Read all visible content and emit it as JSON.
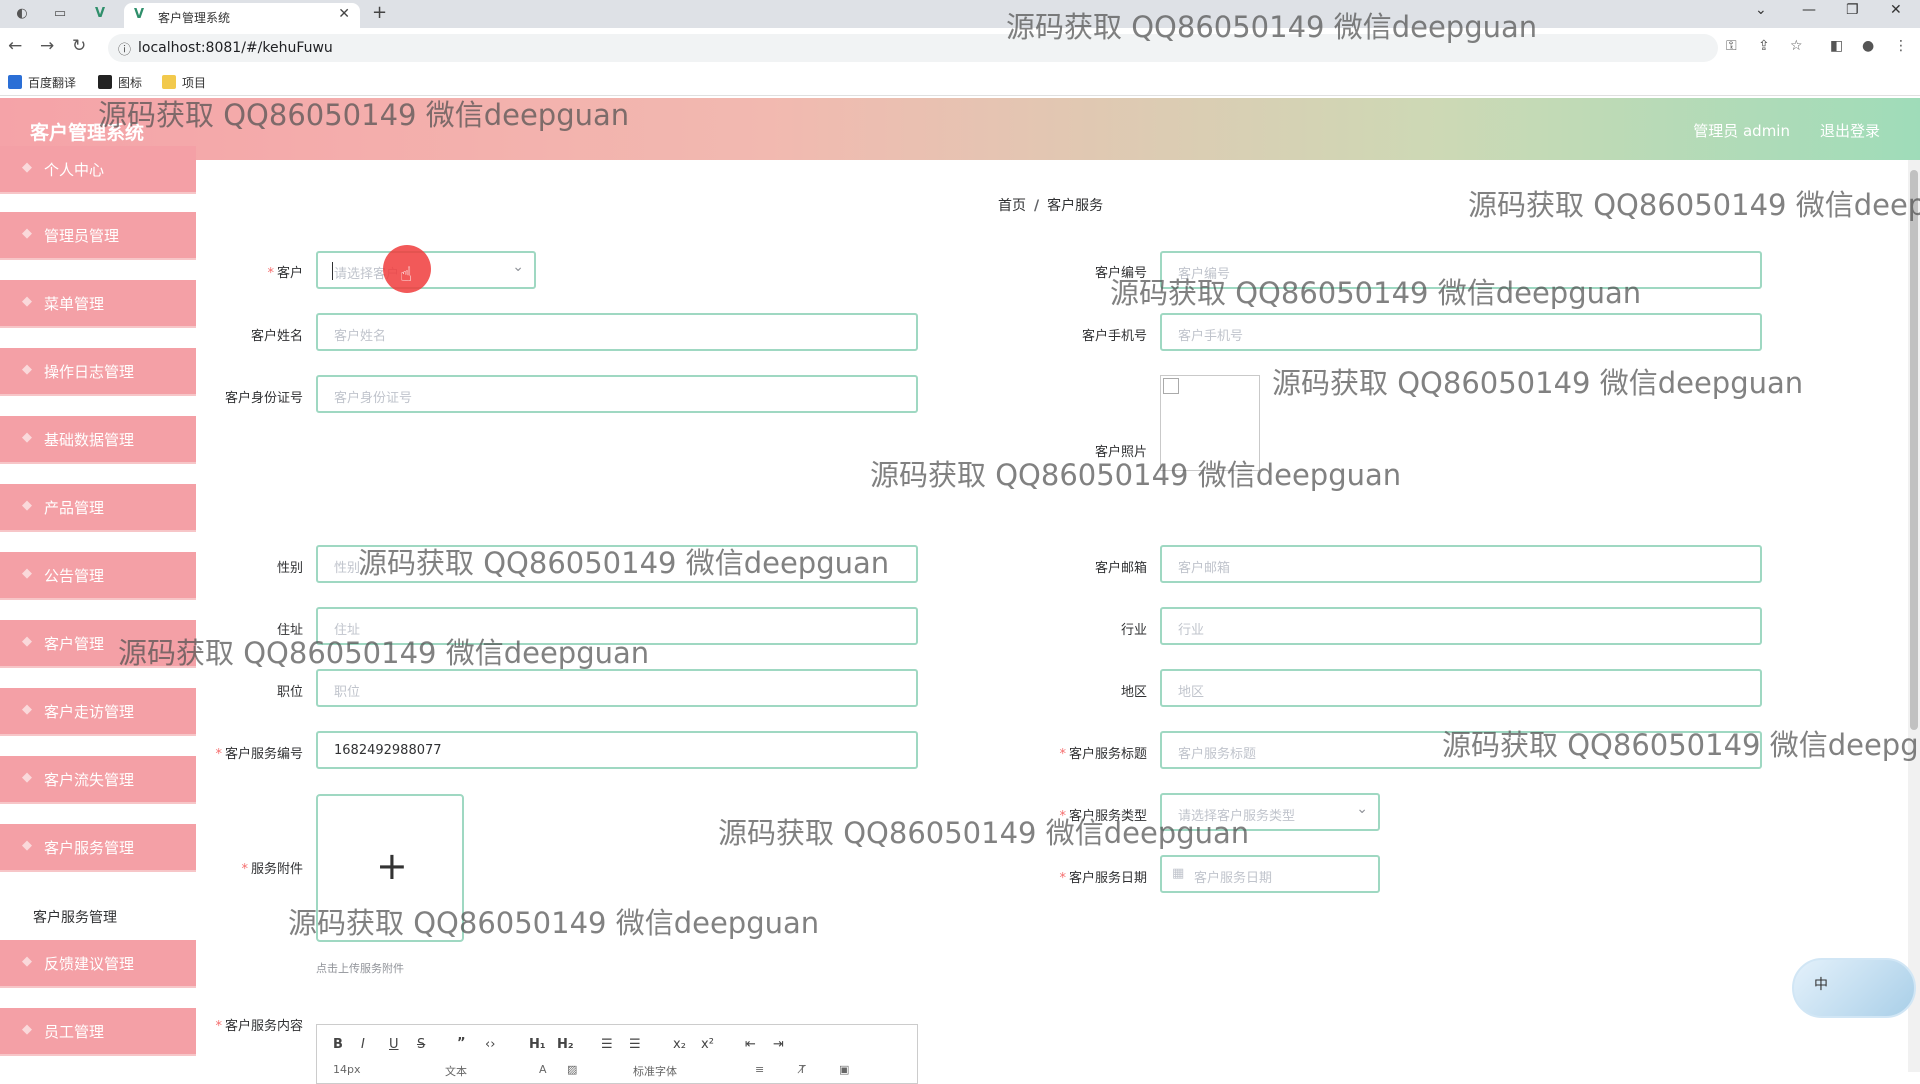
{
  "browser": {
    "tab_title": "客户管理系统",
    "url": "localhost:8081/#/kehuFuwu",
    "bookmarks": [
      "百度翻译",
      "图标",
      "项目"
    ]
  },
  "header": {
    "title": "客户管理系统",
    "admin": "管理员 admin",
    "logout": "退出登录"
  },
  "sidebar": {
    "items": [
      "个人中心",
      "管理员管理",
      "菜单管理",
      "操作日志管理",
      "基础数据管理",
      "产品管理",
      "公告管理",
      "客户管理",
      "客户走访管理",
      "客户流失管理",
      "客户服务管理"
    ],
    "sub_item": "客户服务管理",
    "items_after": [
      "反馈建议管理",
      "员工管理"
    ]
  },
  "breadcrumb": {
    "home": "首页",
    "current": "客户服务"
  },
  "form": {
    "kehu": {
      "label": "客户",
      "placeholder": "请选择客户"
    },
    "kehu_number": {
      "label": "客户编号",
      "placeholder": "客户编号"
    },
    "kehu_name": {
      "label": "客户姓名",
      "placeholder": "客户姓名"
    },
    "kehu_phone": {
      "label": "客户手机号",
      "placeholder": "客户手机号"
    },
    "kehu_idcard": {
      "label": "客户身份证号",
      "placeholder": "客户身份证号"
    },
    "kehu_photo": {
      "label": "客户照片"
    },
    "gender": {
      "label": "性别",
      "placeholder": "性别"
    },
    "kehu_email": {
      "label": "客户邮箱",
      "placeholder": "客户邮箱"
    },
    "address": {
      "label": "住址",
      "placeholder": "住址"
    },
    "industry": {
      "label": "行业",
      "placeholder": "行业"
    },
    "position": {
      "label": "职位",
      "placeholder": "职位"
    },
    "region": {
      "label": "地区",
      "placeholder": "地区"
    },
    "service_number": {
      "label": "客户服务编号",
      "value": "1682492988077"
    },
    "service_title": {
      "label": "客户服务标题",
      "placeholder": "客户服务标题"
    },
    "service_type": {
      "label": "客户服务类型",
      "placeholder": "请选择客户服务类型"
    },
    "attachment": {
      "label": "服务附件",
      "hint": "点击上传服务附件"
    },
    "service_date": {
      "label": "客户服务日期",
      "placeholder": "客户服务日期"
    },
    "service_content": {
      "label": "客户服务内容"
    }
  },
  "editor": {
    "font_size": "14px",
    "block": "文本",
    "font_family": "标准字体"
  },
  "ime": {
    "label": "中"
  },
  "watermark": "源码获取 QQ86050149 微信deepguan"
}
